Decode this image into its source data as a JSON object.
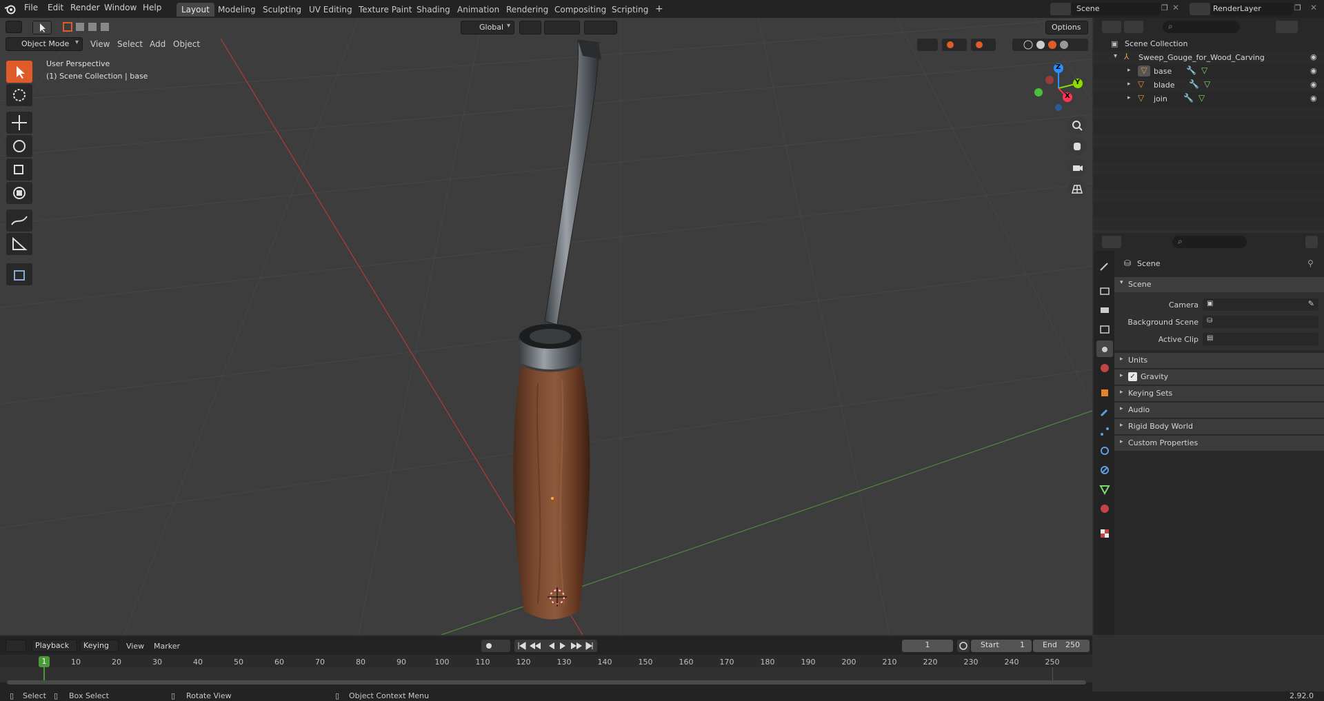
{
  "menubar": {
    "items": [
      "File",
      "Edit",
      "Render",
      "Window",
      "Help"
    ],
    "workspace_tabs": [
      "Layout",
      "Modeling",
      "Sculpting",
      "UV Editing",
      "Texture Paint",
      "Shading",
      "Animation",
      "Rendering",
      "Compositing",
      "Scripting"
    ],
    "active_tab": "Layout",
    "add_tab": "+",
    "scene_name": "Scene",
    "view_layer": "RenderLayer"
  },
  "viewport": {
    "mode": "Object Mode",
    "menus": [
      "View",
      "Select",
      "Add",
      "Object"
    ],
    "transform_orientation": "Global",
    "options_label": "Options",
    "overlay_text_1": "User Perspective",
    "overlay_text_2": "(1) Scene Collection | base",
    "gizmo_axes": {
      "x": "X",
      "y": "Y",
      "z": "Z"
    },
    "colors": {
      "x_axis": "#ff3352",
      "y_axis": "#8bdc00",
      "z_axis": "#2890ff",
      "handle_wood": "#7a4a32",
      "blade_metal": "#6a7076",
      "active_tool": "#e05b2a"
    }
  },
  "outliner": {
    "root": "Scene Collection",
    "collection": "Sweep_Gouge_for_Wood_Carving",
    "objects": [
      "base",
      "blade",
      "join"
    ]
  },
  "properties": {
    "header": "Scene",
    "panel": "Scene",
    "camera_label": "Camera",
    "background_scene_label": "Background Scene",
    "active_clip_label": "Active Clip",
    "sections": [
      "Units",
      "Gravity",
      "Keying Sets",
      "Audio",
      "Rigid Body World",
      "Custom Properties"
    ],
    "gravity_checked": true
  },
  "timeline": {
    "menus": [
      "Playback",
      "Keying",
      "View",
      "Marker"
    ],
    "current_frame": "1",
    "start_label": "Start",
    "start_value": "1",
    "end_label": "End",
    "end_value": "250",
    "ruler": [
      "10",
      "20",
      "30",
      "40",
      "50",
      "60",
      "70",
      "80",
      "90",
      "100",
      "110",
      "120",
      "130",
      "140",
      "150",
      "160",
      "170",
      "180",
      "190",
      "200",
      "210",
      "220",
      "230",
      "240",
      "250"
    ],
    "playhead_label": "1"
  },
  "statusbar": {
    "select": "Select",
    "box_select": "Box Select",
    "rotate_view": "Rotate View",
    "context_menu": "Object Context Menu",
    "version": "2.92.0"
  }
}
